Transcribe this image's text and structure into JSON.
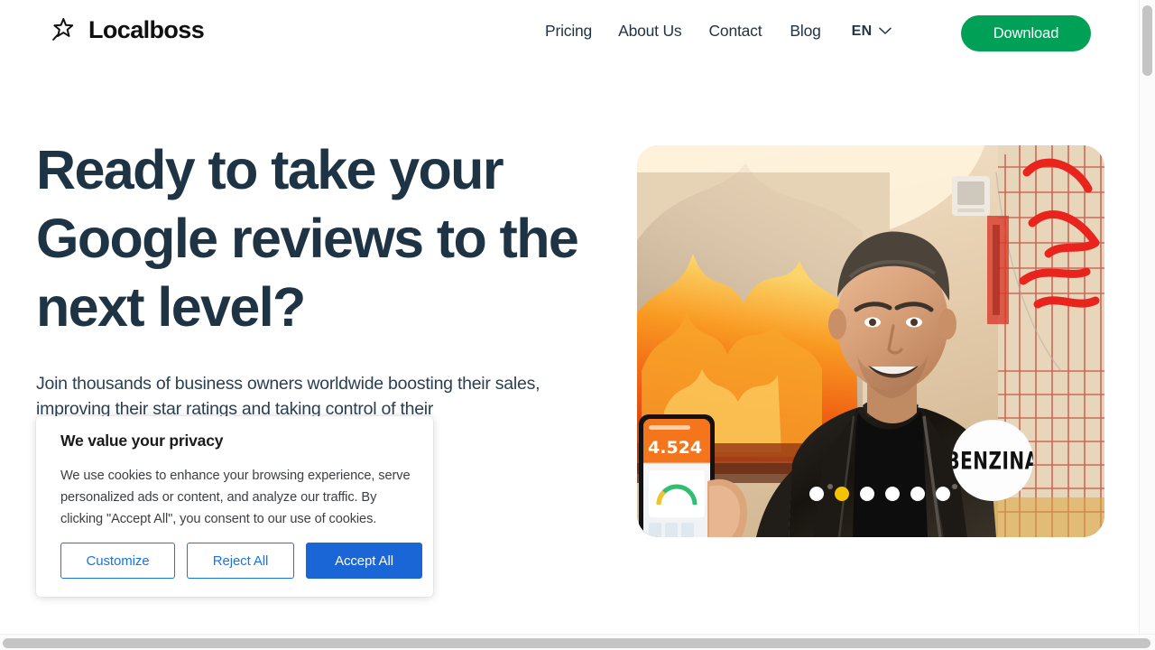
{
  "header": {
    "brand": {
      "name": "Localboss",
      "logo_icon": "star-outline-icon"
    },
    "nav": [
      {
        "label": "Pricing"
      },
      {
        "label": "About Us"
      },
      {
        "label": "Contact"
      },
      {
        "label": "Blog"
      }
    ],
    "language": {
      "code": "EN",
      "chevron_icon": "chevron-down-icon"
    },
    "cta": {
      "label": "Download",
      "color": "#00a057"
    }
  },
  "hero": {
    "heading": "Ready to take your Google reviews to the next level?",
    "heading_color": "#1e3445",
    "subtitle": "Join thousands of business owners worldwide boosting their sales, improving their star ratings and taking control of their",
    "photo": {
      "alt": "Smiling man in black leather jacket holding a phone showing the Localboss app, standing in front of a wall mural of a burning vehicle with red graffiti",
      "phone_rating": "4.524"
    },
    "badge": {
      "text": "BENZINA"
    },
    "carousel": {
      "total": 6,
      "active_index": 1,
      "active_color": "#f5c400",
      "inactive_color": "#ffffff"
    }
  },
  "cookie_banner": {
    "title": "We value your privacy",
    "body": "We use cookies to enhance your browsing experience, serve personalized ads or content, and analyze our traffic. By clicking \"Accept All\", you consent to our use of cookies.",
    "buttons": {
      "customize": "Customize",
      "reject": "Reject All",
      "accept": "Accept All"
    },
    "accent_color": "#1a73e8",
    "accept_color": "#1b66d6"
  },
  "scrollbars": {
    "vertical_present": true,
    "horizontal_present": true
  }
}
